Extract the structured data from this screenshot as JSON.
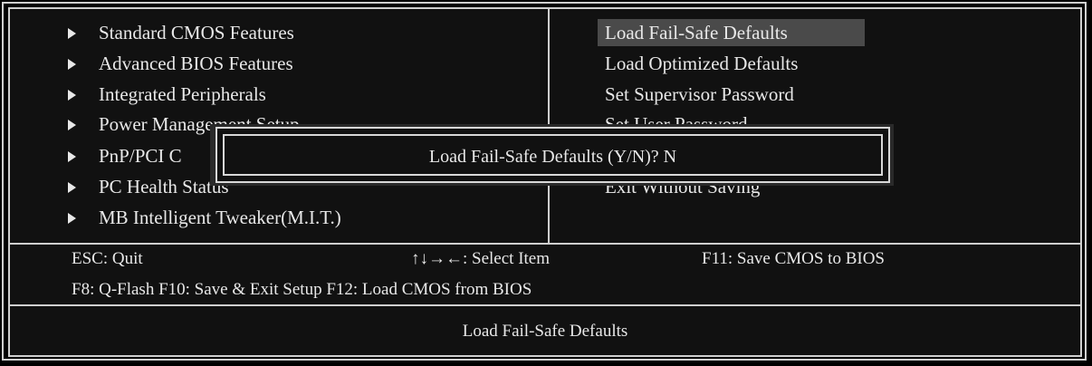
{
  "left_menu": [
    {
      "label": "Standard CMOS Features"
    },
    {
      "label": "Advanced BIOS Features"
    },
    {
      "label": "Integrated Peripherals"
    },
    {
      "label": "Power Management Setup"
    },
    {
      "label": "PnP/PCI C"
    },
    {
      "label": "PC Health Status"
    },
    {
      "label": "MB Intelligent Tweaker(M.I.T.)"
    }
  ],
  "right_menu": [
    {
      "label": "Load Fail-Safe Defaults",
      "selected": true
    },
    {
      "label": "Load Optimized Defaults"
    },
    {
      "label": "Set Supervisor Password"
    },
    {
      "label": "Set User Password"
    },
    {
      "label": "Exit Without Saving"
    }
  ],
  "help": {
    "esc": "ESC: Quit",
    "select": "↑↓→←: Select Item",
    "f11": "F11: Save CMOS to BIOS",
    "line2": "F8: Q-Flash F10: Save & Exit Setup F12: Load CMOS from BIOS"
  },
  "status_bar": "Load Fail-Safe Defaults",
  "dialog": {
    "prompt": "Load Fail-Safe Defaults (Y/N)? N"
  },
  "colors": {
    "background": "#111111",
    "border": "#cfcfcf",
    "selection": "#4a4a4a",
    "text": "#e8e8e8"
  }
}
